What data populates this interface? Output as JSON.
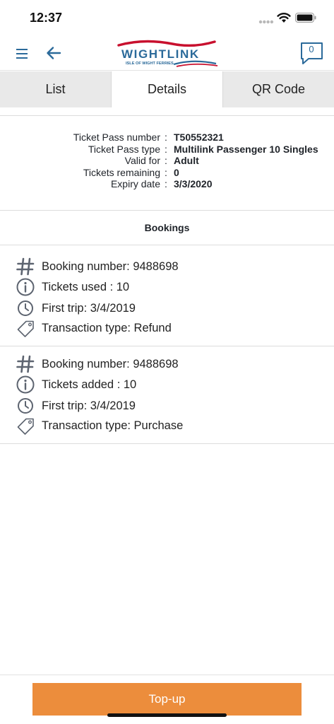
{
  "status_bar": {
    "time": "12:37"
  },
  "header": {
    "logo_text": "WIGHTLINK",
    "logo_subtitle": "ISLE OF WIGHT FERRIES",
    "message_count": "0"
  },
  "tabs": [
    {
      "label": "List",
      "active": false
    },
    {
      "label": "Details",
      "active": true
    },
    {
      "label": "QR Code",
      "active": false
    }
  ],
  "details": [
    {
      "label": "Ticket Pass number",
      "value": "T50552321"
    },
    {
      "label": "Ticket Pass type",
      "value": "Multilink Passenger 10 Singles"
    },
    {
      "label": "Valid for",
      "value": "Adult"
    },
    {
      "label": "Tickets remaining",
      "value": "0"
    },
    {
      "label": "Expiry date",
      "value": "3/3/2020"
    }
  ],
  "details_colon": ":",
  "bookings_heading": "Bookings",
  "bookings": [
    {
      "booking_number": "Booking number: 9488698",
      "tickets": "Tickets used : 10",
      "first_trip": "First trip: 3/4/2019",
      "transaction_type": "Transaction type: Refund"
    },
    {
      "booking_number": "Booking number: 9488698",
      "tickets": "Tickets added : 10",
      "first_trip": "First trip: 3/4/2019",
      "transaction_type": "Transaction type: Purchase"
    }
  ],
  "topup_label": "Top-up",
  "colors": {
    "accent": "#2b6a9a",
    "logo_red": "#c8102e",
    "button": "#ec8d3c",
    "icon_gray": "#5d6470"
  }
}
